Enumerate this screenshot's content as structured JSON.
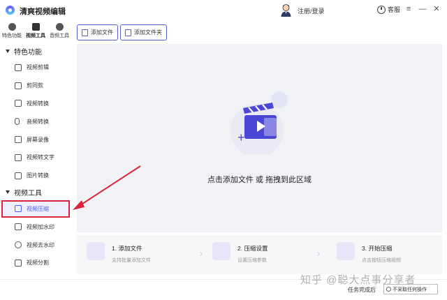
{
  "app": {
    "title": "清爽视频编辑"
  },
  "header": {
    "login_label": "注册/登录",
    "support_label": "客服",
    "menu_glyph": "≡",
    "minimize_glyph": "—",
    "close_glyph": "✕"
  },
  "sidebar": {
    "topnav": [
      {
        "label": "特色功能",
        "icon": "star-icon"
      },
      {
        "label": "视频工具",
        "icon": "film-icon"
      },
      {
        "label": "音频工具",
        "icon": "music-icon"
      }
    ],
    "section_featured": "特色功能",
    "featured_items": [
      {
        "label": "视频剪辑",
        "icon": "scissors-icon"
      },
      {
        "label": "剪同款",
        "icon": "template-icon"
      },
      {
        "label": "视频转换",
        "icon": "convert-icon"
      },
      {
        "label": "音频转换",
        "icon": "microphone-icon"
      },
      {
        "label": "屏幕录像",
        "icon": "screen-record-icon"
      },
      {
        "label": "视频转文字",
        "icon": "video-text-icon"
      },
      {
        "label": "图片转换",
        "icon": "image-icon"
      }
    ],
    "section_tools": "视频工具",
    "tool_items": [
      {
        "label": "视频压缩",
        "icon": "compress-icon",
        "active": true
      },
      {
        "label": "视频加水印",
        "icon": "watermark-add-icon"
      },
      {
        "label": "视频去水印",
        "icon": "watermark-remove-icon"
      },
      {
        "label": "视频分割",
        "icon": "split-icon"
      }
    ]
  },
  "toolbar": {
    "add_file": "添加文件",
    "add_folder": "添加文件夹"
  },
  "drop_area": {
    "text": "点击添加文件 或 拖拽到此区域"
  },
  "steps": [
    {
      "title": "1. 添加文件",
      "subtitle": "支持批量添加文件"
    },
    {
      "title": "2. 压缩设置",
      "subtitle": "设置压缩参数"
    },
    {
      "title": "3. 开始压缩",
      "subtitle": "点击按钮压缩视频"
    }
  ],
  "footer": {
    "task_done_label": "任务完成后",
    "after_task_option": "不采取任何操作"
  },
  "watermark": "知乎 @聪大点事分享者",
  "colors": {
    "accent": "#4b5cff",
    "highlight_border": "#d9243a",
    "drop_bg": "#f1f2f6"
  }
}
